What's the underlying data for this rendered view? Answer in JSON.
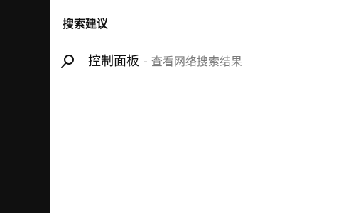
{
  "panel": {
    "section_title": "搜索建议"
  },
  "suggestion": {
    "icon": "search-icon",
    "primary_text": "控制面板",
    "secondary_text": "- 查看网络搜索结果"
  },
  "colors": {
    "left_rail": "#101010",
    "panel_bg": "#ffffff",
    "primary_text": "#111111",
    "secondary_text": "#7a7a7a"
  }
}
